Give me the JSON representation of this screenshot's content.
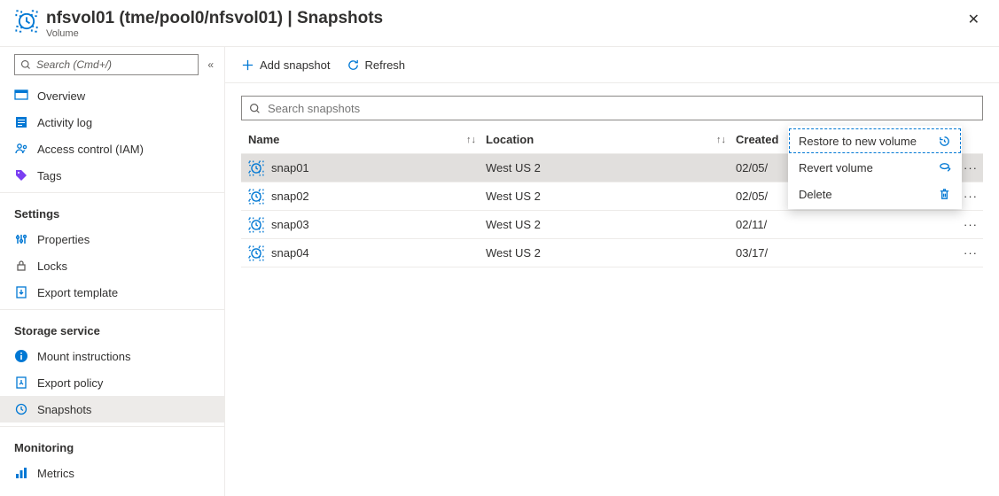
{
  "header": {
    "title": "nfsvol01 (tme/pool0/nfsvol01) | Snapshots",
    "subtitle": "Volume"
  },
  "sidebar": {
    "search_placeholder": "Search (Cmd+/)",
    "groups": [
      {
        "label": "",
        "items": [
          {
            "label": "Overview",
            "icon": "overview"
          },
          {
            "label": "Activity log",
            "icon": "activity"
          },
          {
            "label": "Access control (IAM)",
            "icon": "access"
          },
          {
            "label": "Tags",
            "icon": "tags"
          }
        ]
      },
      {
        "label": "Settings",
        "items": [
          {
            "label": "Properties",
            "icon": "properties"
          },
          {
            "label": "Locks",
            "icon": "locks"
          },
          {
            "label": "Export template",
            "icon": "export-template"
          }
        ]
      },
      {
        "label": "Storage service",
        "items": [
          {
            "label": "Mount instructions",
            "icon": "mount"
          },
          {
            "label": "Export policy",
            "icon": "export-policy"
          },
          {
            "label": "Snapshots",
            "icon": "snapshot",
            "selected": true
          }
        ]
      },
      {
        "label": "Monitoring",
        "items": [
          {
            "label": "Metrics",
            "icon": "metrics"
          }
        ]
      }
    ]
  },
  "toolbar": {
    "add_label": "Add snapshot",
    "refresh_label": "Refresh"
  },
  "search": {
    "placeholder": "Search snapshots"
  },
  "columns": {
    "name": "Name",
    "location": "Location",
    "created": "Created"
  },
  "rows": [
    {
      "name": "snap01",
      "location": "West US 2",
      "created": "02/05/",
      "selected": true
    },
    {
      "name": "snap02",
      "location": "West US 2",
      "created": "02/05/"
    },
    {
      "name": "snap03",
      "location": "West US 2",
      "created": "02/11/"
    },
    {
      "name": "snap04",
      "location": "West US 2",
      "created": "03/17/"
    }
  ],
  "context_menu": {
    "restore": "Restore to new volume",
    "revert": "Revert volume",
    "delete": "Delete"
  }
}
